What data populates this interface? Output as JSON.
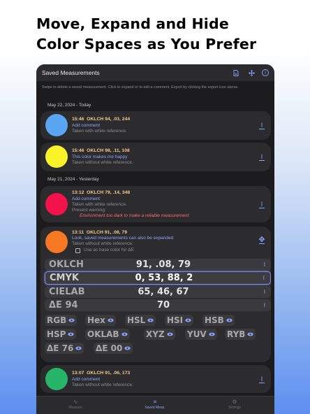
{
  "headline": [
    "Move, Expand and Hide",
    "Color Spaces as You Prefer"
  ],
  "app": {
    "title": "Saved Measurements",
    "hint": "Swipe to delete a saved measurement. Click to expand or to edit a comment. Export by clicking the export icon above.",
    "icons": [
      "export-icon",
      "move-icon",
      "info-icon"
    ]
  },
  "groups": [
    {
      "date": "May 22, 2024 - Today"
    },
    {
      "date": "May 21, 2024 - Yesterday"
    }
  ],
  "measurements": [
    {
      "time": "15:46",
      "value": "OKLCH 94, .03, 244",
      "comment": "Add comment",
      "reference": "Taken with white reference.",
      "color": "#5aa6f2"
    },
    {
      "time": "15:46",
      "value": "OKLCH 98, .11, 108",
      "comment": "This color makes me happy",
      "reference": "Taken without white reference.",
      "color": "#fbf32a"
    },
    {
      "time": "13:12",
      "value": "OKLCH 79, .14, 348",
      "comment": "Add comment",
      "reference": "Taken with white reference.",
      "warning_label": "Present warning:",
      "warning": "Environment too dark to make a reliable measurement",
      "color": "#f2134a"
    },
    {
      "time": "13:11",
      "value": "OKLCH 91, .08, 79",
      "comment": "Look, saved measurements can also be expanded",
      "reference": "Taken without white reference.",
      "base_label": "Use as base color for ΔE",
      "color": "#f67822"
    },
    {
      "time": "13:07",
      "value": "OKLCH 91, .06, 173",
      "comment": "Add comment",
      "reference": "Taken without white reference.",
      "color": "#27b56a"
    }
  ],
  "color_spaces": [
    {
      "label": "OKLCH",
      "value": "91, .08, 79"
    },
    {
      "label": "CMYK",
      "value": "0, 53, 88, 2"
    },
    {
      "label": "CIELAB",
      "value": "65, 46, 67"
    },
    {
      "label": "ΔE 94",
      "value": "70"
    }
  ],
  "hidden_spaces": [
    "RGB",
    "Hex",
    "HSL",
    "HSI",
    "HSB",
    "HSP",
    "OKLAB",
    "XYZ",
    "YUV",
    "RYB",
    "ΔE 76",
    "ΔE 00"
  ],
  "tabs": [
    {
      "label": "Measure",
      "icon": "wifi-icon"
    },
    {
      "label": "Saved Meas.",
      "icon": "list-icon"
    },
    {
      "label": "Settings",
      "icon": "gear-icon"
    }
  ],
  "colors": {
    "accent": "#8aa4ff",
    "background": "#1c1c1e",
    "card": "#2c2c2e",
    "time": "#f5c88a",
    "warning": "#ff6b6b"
  }
}
